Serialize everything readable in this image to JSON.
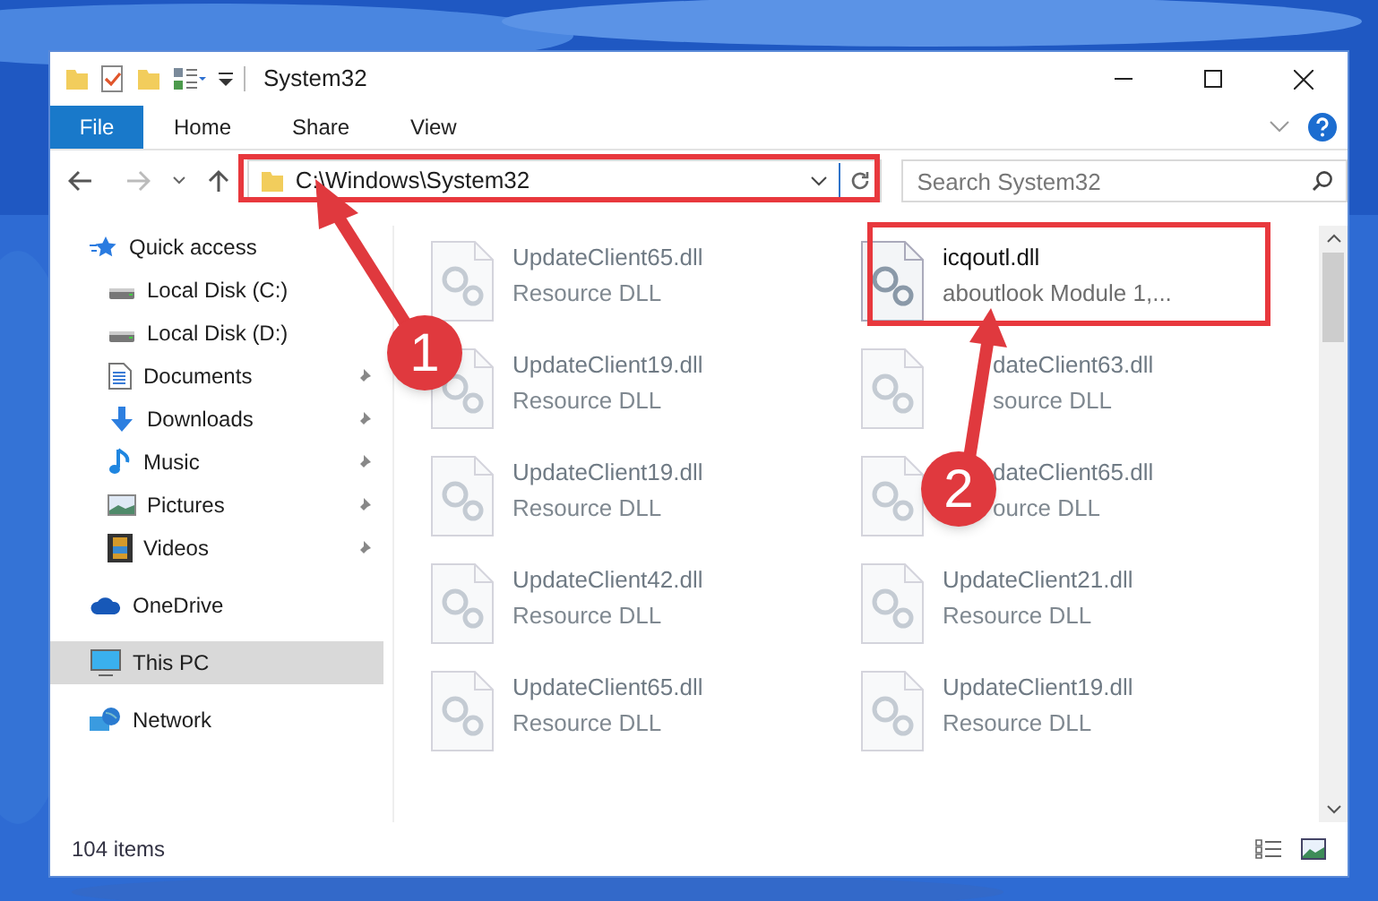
{
  "window": {
    "title": "System32"
  },
  "ribbon_tabs": [
    {
      "label": "File",
      "kind": "file"
    },
    {
      "label": "Home",
      "kind": "tab"
    },
    {
      "label": "Share",
      "kind": "tab"
    },
    {
      "label": "View",
      "kind": "tab"
    }
  ],
  "address": {
    "value": "C:\\Windows\\System32"
  },
  "search": {
    "placeholder": "Search System32"
  },
  "navigation": [
    {
      "label": "Quick access",
      "kind": "star",
      "selected": false,
      "children": [
        {
          "label": "Local Disk (C:)",
          "kind": "drive",
          "pinned": false,
          "selected": false
        },
        {
          "label": "Local Disk (D:)",
          "kind": "drive",
          "pinned": false,
          "selected": false
        },
        {
          "label": "Documents",
          "kind": "document",
          "pinned": true,
          "selected": false
        },
        {
          "label": "Downloads",
          "kind": "download",
          "pinned": true,
          "selected": false
        },
        {
          "label": "Music",
          "kind": "music",
          "pinned": true,
          "selected": false
        },
        {
          "label": "Pictures",
          "kind": "pictures",
          "pinned": true,
          "selected": false
        },
        {
          "label": "Videos",
          "kind": "videos",
          "pinned": true,
          "selected": false
        }
      ]
    },
    {
      "label": "OneDrive",
      "kind": "cloud",
      "selected": false
    },
    {
      "label": "This PC",
      "kind": "pc",
      "selected": true
    },
    {
      "label": "Network",
      "kind": "network",
      "selected": false
    }
  ],
  "files": [
    {
      "name": "UpdateClient65.dll",
      "description": "Resource DLL",
      "blurred": true
    },
    {
      "name": "icqoutl.dll",
      "description": "aboutlook Module 1,...",
      "blurred": false
    },
    {
      "name": "UpdateClient19.dll",
      "description": "Resource DLL",
      "blurred": true
    },
    {
      "name": "dateClient63.dll",
      "description": "source DLL",
      "blurred": true
    },
    {
      "name": "UpdateClient19.dll",
      "description": "Resource DLL",
      "blurred": true
    },
    {
      "name": "dateClient65.dll",
      "description": "ource DLL",
      "blurred": true
    },
    {
      "name": "UpdateClient42.dll",
      "description": "Resource DLL",
      "blurred": true
    },
    {
      "name": "UpdateClient21.dll",
      "description": "Resource DLL",
      "blurred": true
    },
    {
      "name": "UpdateClient65.dll",
      "description": "Resource DLL",
      "blurred": true
    },
    {
      "name": "UpdateClient19.dll",
      "description": "Resource DLL",
      "blurred": true
    }
  ],
  "status_bar": {
    "item_count": "104 items"
  },
  "annotations": [
    {
      "number": "1"
    },
    {
      "number": "2"
    }
  ]
}
